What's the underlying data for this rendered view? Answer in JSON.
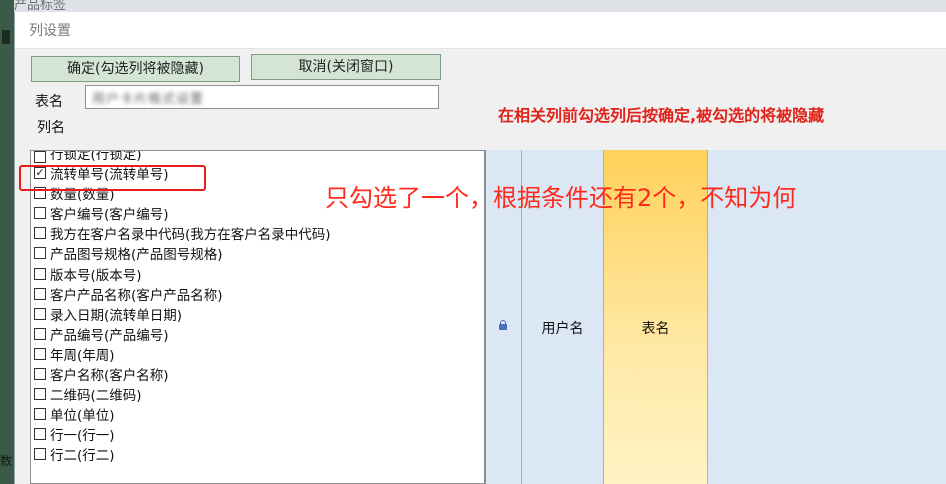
{
  "background": {
    "tab_text": "产品标签",
    "left_glyph": "数"
  },
  "dialog": {
    "title": "列设置",
    "ok_button": "确定(勾选列将被隐藏)",
    "cancel_button": "取消(关闭窗口)",
    "table_name_label": "表名",
    "table_name_value": "用户卡片格式设置",
    "column_name_label": "列名",
    "hint": "在相关列前勾选列后按确定,被勾选的将被隐藏"
  },
  "annotation": "只勾选了一个，根据条件还有2个，不知为何",
  "columns": [
    {
      "label": "行锁定(行锁定)",
      "checked": false
    },
    {
      "label": "流转单号(流转单号)",
      "checked": true
    },
    {
      "label": "数量(数量)",
      "checked": false
    },
    {
      "label": "客户编号(客户编号)",
      "checked": false
    },
    {
      "label": "我方在客户名录中代码(我方在客户名录中代码)",
      "checked": false
    },
    {
      "label": "产品图号规格(产品图号规格)",
      "checked": false
    },
    {
      "label": "版本号(版本号)",
      "checked": false
    },
    {
      "label": "客户产品名称(客户产品名称)",
      "checked": false
    },
    {
      "label": "录入日期(流转单日期)",
      "checked": false
    },
    {
      "label": "产品编号(产品编号)",
      "checked": false
    },
    {
      "label": "年周(年周)",
      "checked": false
    },
    {
      "label": "客户名称(客户名称)",
      "checked": false
    },
    {
      "label": "二维码(二维码)",
      "checked": false
    },
    {
      "label": "单位(单位)",
      "checked": false
    },
    {
      "label": "行一(行一)",
      "checked": false
    },
    {
      "label": "行二(行二)",
      "checked": false
    }
  ],
  "grid": {
    "headers": [
      "用户名",
      "表名"
    ],
    "lock_icon": "lock-icon",
    "highlight_color": "#ffd15a"
  },
  "colors": {
    "button_bg": "#d4e5d6",
    "hint_red": "#e0231a",
    "annotation_red": "#ff2b1a",
    "grid_bg": "#dae6f3"
  }
}
